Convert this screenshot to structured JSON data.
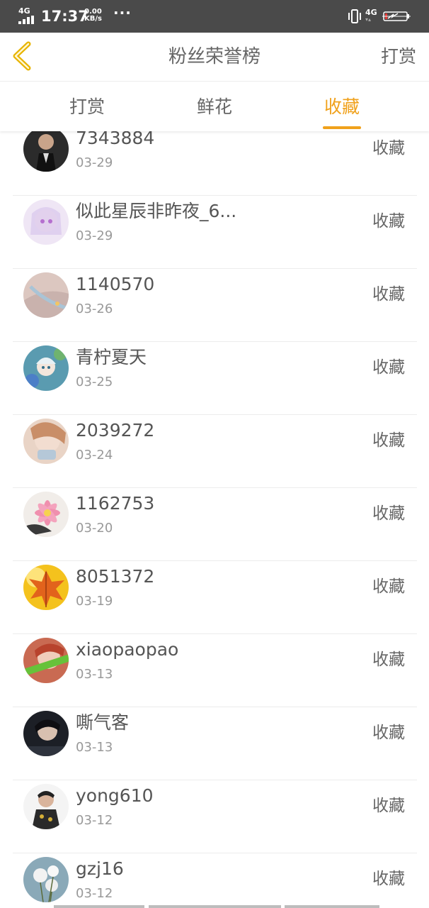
{
  "status_bar": {
    "network": "4G",
    "time": "17:37",
    "speed_value": "0.00",
    "speed_unit": "KB/s",
    "more": "···",
    "network_right": "4G"
  },
  "header": {
    "title": "粉丝荣誉榜",
    "right_action": "打赏"
  },
  "tabs": [
    {
      "label": "打赏",
      "active": false
    },
    {
      "label": "鲜花",
      "active": false
    },
    {
      "label": "收藏",
      "active": true
    }
  ],
  "colors": {
    "accent": "#f0a11b",
    "status_bar": "#4a4a4a"
  },
  "fans": [
    {
      "name": "7343884",
      "date": "03-29",
      "action": "收藏"
    },
    {
      "name": "似此星辰非昨夜_6...",
      "date": "03-29",
      "action": "收藏"
    },
    {
      "name": "1140570",
      "date": "03-26",
      "action": "收藏"
    },
    {
      "name": "青柠夏天",
      "date": "03-25",
      "action": "收藏"
    },
    {
      "name": "2039272",
      "date": "03-24",
      "action": "收藏"
    },
    {
      "name": "1162753",
      "date": "03-20",
      "action": "收藏"
    },
    {
      "name": "8051372",
      "date": "03-19",
      "action": "收藏"
    },
    {
      "name": "xiaopaopao",
      "date": "03-13",
      "action": "收藏"
    },
    {
      "name": "嘶气客",
      "date": "03-13",
      "action": "收藏"
    },
    {
      "name": "yong610",
      "date": "03-12",
      "action": "收藏"
    },
    {
      "name": "gzj16",
      "date": "03-12",
      "action": "收藏"
    }
  ]
}
